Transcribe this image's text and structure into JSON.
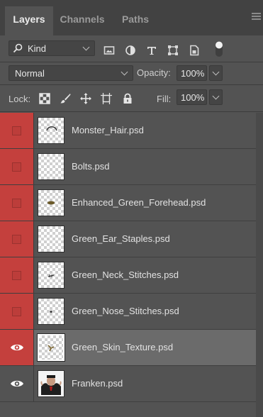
{
  "tabs": [
    {
      "label": "Layers"
    },
    {
      "label": "Channels"
    },
    {
      "label": "Paths"
    }
  ],
  "filter": {
    "kind_label": "Kind",
    "icons": [
      "image-filter-icon",
      "adjustment-filter-icon",
      "type-filter-icon",
      "shape-filter-icon",
      "smart-object-filter-icon",
      "filter-toggle-icon"
    ]
  },
  "blend": {
    "mode": "Normal",
    "opacity_label": "Opacity:",
    "opacity_value": "100%"
  },
  "lock": {
    "label": "Lock:",
    "icons": [
      "lock-transparent-pixels-icon",
      "lock-image-pixels-icon",
      "lock-position-icon",
      "lock-artboard-icon",
      "lock-all-icon"
    ],
    "fill_label": "Fill:",
    "fill_value": "100%"
  },
  "layers": [
    {
      "name": "Monster_Hair.psd",
      "visible": false,
      "label_color": "#c4403d",
      "selected": false
    },
    {
      "name": "Bolts.psd",
      "visible": false,
      "label_color": "#c4403d",
      "selected": false
    },
    {
      "name": "Enhanced_Green_Forehead.psd",
      "visible": false,
      "label_color": "#c4403d",
      "selected": false
    },
    {
      "name": "Green_Ear_Staples.psd",
      "visible": false,
      "label_color": "#c4403d",
      "selected": false
    },
    {
      "name": "Green_Neck_Stitches.psd",
      "visible": false,
      "label_color": "#c4403d",
      "selected": false
    },
    {
      "name": "Green_Nose_Stitches.psd",
      "visible": false,
      "label_color": "#c4403d",
      "selected": false
    },
    {
      "name": "Green_Skin_Texture.psd",
      "visible": true,
      "label_color": "#c4403d",
      "selected": true
    },
    {
      "name": "Franken.psd",
      "visible": true,
      "label_color": null,
      "selected": false
    }
  ]
}
